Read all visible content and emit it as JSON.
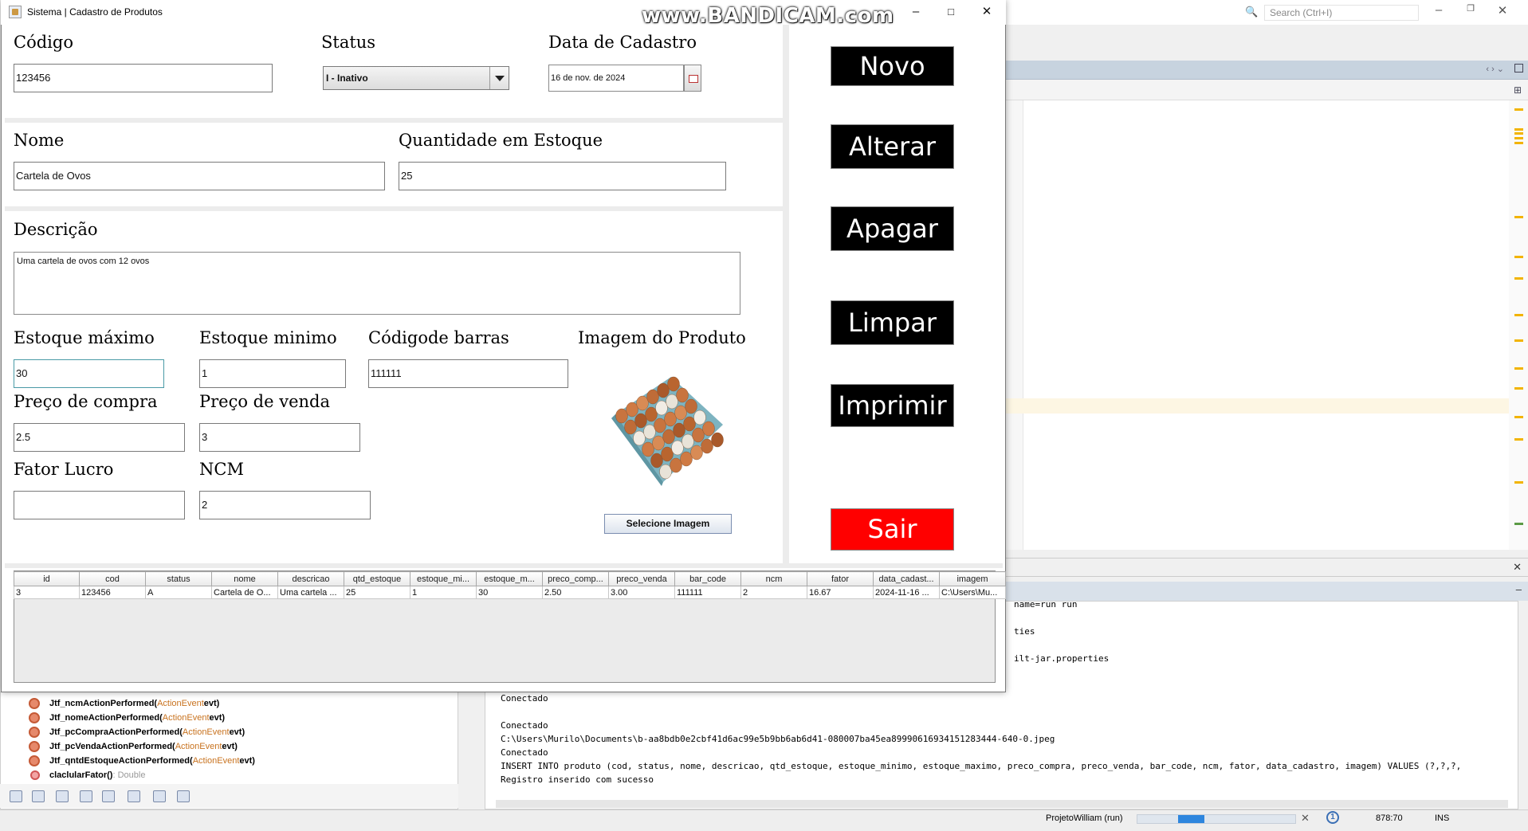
{
  "watermark": "www.BANDICAM.com",
  "window": {
    "title": "Sistema | Cadastro de Produtos",
    "controls": [
      "minimize-icon",
      "maximize-icon",
      "close-icon"
    ]
  },
  "form": {
    "codigo_label": "Código",
    "codigo_value": "123456",
    "status_label": "Status",
    "status_value": "I - Inativo",
    "data_label": "Data de Cadastro",
    "data_value": "16 de nov. de 2024",
    "nome_label": "Nome",
    "nome_value": "Cartela de Ovos",
    "qtd_label": "Quantidade em Estoque",
    "qtd_value": "25",
    "desc_label": "Descrição",
    "desc_value": "Uma cartela de ovos com 12 ovos",
    "estmax_label": "Estoque máximo",
    "estmax_value": "30",
    "estmin_label": "Estoque minimo",
    "estmin_value": "1",
    "barras_label": "Códigode barras",
    "barras_value": "111111",
    "img_label": "Imagem do Produto",
    "pcompra_label": "Preço de compra",
    "pcompra_value": "2.5",
    "pvenda_label": "Preço de venda",
    "pvenda_value": "3",
    "fator_label": "Fator Lucro",
    "fator_value": "",
    "ncm_label": "NCM",
    "ncm_value": "2",
    "sel_img_button": "Selecione Imagem"
  },
  "actions": {
    "novo": "Novo",
    "alterar": "Alterar",
    "apagar": "Apagar",
    "limpar": "Limpar",
    "imprimir": "Imprimir",
    "sair": "Sair",
    "sair_color": "#ff0000"
  },
  "table": {
    "columns": [
      "id",
      "cod",
      "status",
      "nome",
      "descricao",
      "qtd_estoque",
      "estoque_mi...",
      "estoque_m...",
      "preco_comp...",
      "preco_venda",
      "bar_code",
      "ncm",
      "fator",
      "data_cadast...",
      "imagem"
    ],
    "rows": [
      [
        "3",
        "123456",
        "A",
        "Cartela de O...",
        "Uma cartela ...",
        "25",
        "1",
        "30",
        "2.50",
        "3.00",
        "111111",
        "2",
        "16.67",
        "2024-11-16 ...",
        "C:\\Users\\Mu..."
      ]
    ]
  },
  "ide": {
    "search_placeholder": "Search (Ctrl+I)",
    "output_right": [
      "name=run run",
      "",
      "ties",
      "",
      "ilt-jar.properties"
    ],
    "output_lines": [
      "Conectado",
      "",
      "Conectado",
      "C:\\Users\\Murilo\\Documents\\b-aa8bdb0e2cbf41d6ac99e5b9bb6ab6d41-080007ba45ea89990616934151283444-640-0.jpeg",
      "Conectado",
      "INSERT INTO produto (cod, status, nome, descricao, qtd_estoque, estoque_minimo, estoque_maximo, preco_compra, preco_venda, bar_code, ncm, fator, data_cadastro, imagem) VALUES (?,?,?,",
      "Registro inserido com sucesso"
    ],
    "navigator": [
      {
        "name": "Jtf_ncmActionPerformed(",
        "type": "ActionEvent",
        "rest": " evt)"
      },
      {
        "name": "Jtf_nomeActionPerformed(",
        "type": "ActionEvent",
        "rest": " evt)"
      },
      {
        "name": "Jtf_pcCompraActionPerformed(",
        "type": "ActionEvent",
        "rest": " evt)"
      },
      {
        "name": "Jtf_pcVendaActionPerformed(",
        "type": "ActionEvent",
        "rest": " evt)"
      },
      {
        "name": "Jtf_qntdEstoqueActionPerformed(",
        "type": "ActionEvent",
        "rest": " evt)"
      },
      {
        "name": "claclularFator()",
        "type": "",
        "rest": " : Double"
      }
    ],
    "status_project": "ProjetoWilliam (run)",
    "status_progress": 0.3,
    "status_position": "878:70",
    "status_mode": "INS"
  }
}
